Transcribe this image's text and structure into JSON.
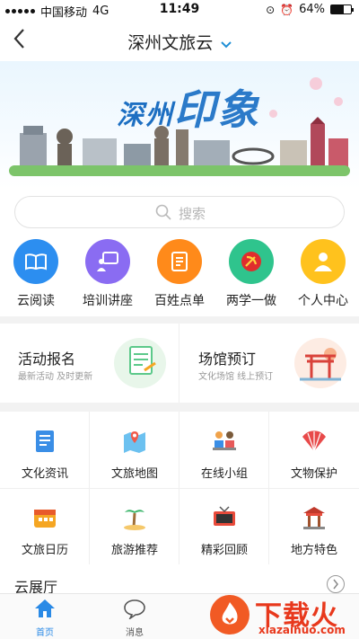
{
  "status_bar": {
    "carrier": "中国移动",
    "network": "4G",
    "time": "11:49",
    "battery": "64%",
    "battery_level": 0.64
  },
  "nav": {
    "title": "深州文旅云"
  },
  "banner": {
    "title_small": "深州",
    "title_big": "印象"
  },
  "search": {
    "placeholder": "搜索"
  },
  "quick_menu": [
    {
      "label": "云阅读",
      "color": "#2c8ef0",
      "icon": "book-icon"
    },
    {
      "label": "培训讲座",
      "color": "#8a6cf2",
      "icon": "lecture-icon"
    },
    {
      "label": "百姓点单",
      "color": "#ff8a1a",
      "icon": "order-icon"
    },
    {
      "label": "两学一做",
      "color": "#2fc48d",
      "icon": "party-emblem-icon"
    },
    {
      "label": "个人中心",
      "color": "#ffc21d",
      "icon": "user-icon"
    }
  ],
  "cards": [
    {
      "title": "活动报名",
      "subtitle": "最新活动 及时更新"
    },
    {
      "title": "场馆预订",
      "subtitle": "文化场馆 线上预订"
    }
  ],
  "grid": [
    {
      "label": "文化资讯",
      "icon": "news-icon"
    },
    {
      "label": "文旅地图",
      "icon": "map-icon"
    },
    {
      "label": "在线小组",
      "icon": "group-icon"
    },
    {
      "label": "文物保护",
      "icon": "fan-icon"
    },
    {
      "label": "文旅日历",
      "icon": "calendar-icon"
    },
    {
      "label": "旅游推荐",
      "icon": "palm-tree-icon"
    },
    {
      "label": "精彩回顾",
      "icon": "tv-icon"
    },
    {
      "label": "地方特色",
      "icon": "pavilion-icon"
    }
  ],
  "exhibition": {
    "title": "云展厅"
  },
  "tabbar": [
    {
      "label": "首页",
      "active": true
    },
    {
      "label": "消息",
      "active": false
    }
  ],
  "watermark": {
    "name": "下载火",
    "url": "xiazaihuo.com"
  }
}
